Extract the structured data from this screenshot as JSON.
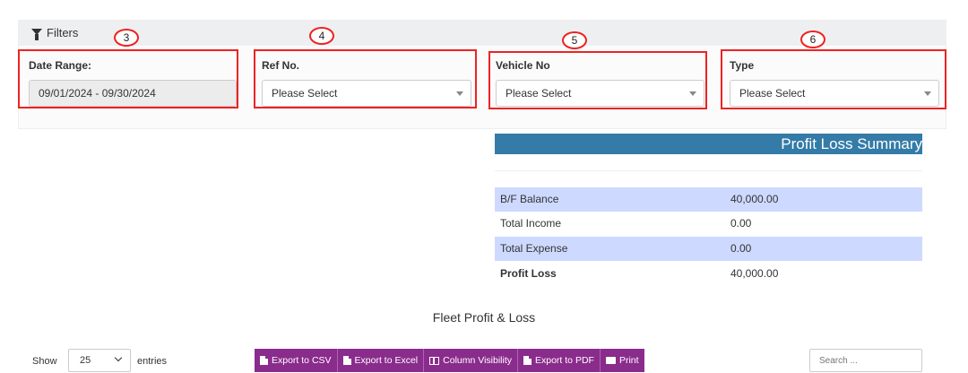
{
  "filters": {
    "title": "Filters",
    "date_range": {
      "label": "Date Range:",
      "value": "09/01/2024 - 09/30/2024",
      "marker": "3"
    },
    "ref_no": {
      "label": "Ref No.",
      "value": "Please Select",
      "marker": "4"
    },
    "vehicle_no": {
      "label": "Vehicle No",
      "value": "Please Select",
      "marker": "5"
    },
    "type": {
      "label": "Type",
      "value": "Please Select",
      "marker": "6"
    }
  },
  "summary": {
    "title": "Profit Loss Summary",
    "rows": [
      {
        "label": "B/F Balance",
        "value": "40,000.00"
      },
      {
        "label": "Total Income",
        "value": "0.00"
      },
      {
        "label": "Total Expense",
        "value": "0.00"
      },
      {
        "label": "Profit Loss",
        "value": "40,000.00"
      }
    ]
  },
  "report": {
    "title": "Fleet Profit & Loss",
    "show_label": "Show",
    "page_length": "25",
    "entries_label": "entries",
    "buttons": {
      "csv": "Export to CSV",
      "excel": "Export to Excel",
      "columns": "Column Visibility",
      "pdf": "Export to PDF",
      "print": "Print"
    },
    "search_placeholder": "Search ..."
  },
  "colors": {
    "summary_header": "#347ba7",
    "band": "#cdd9ff",
    "button": "#8a2c8c",
    "annotation": "#e22222"
  }
}
